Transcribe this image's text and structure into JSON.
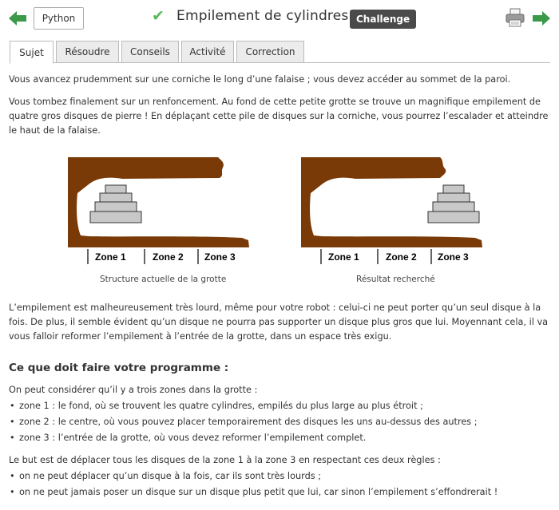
{
  "header": {
    "language_button": "Python",
    "title": "Empilement de cylindres",
    "badge": "Challenge",
    "accent_green": "#5cb85c"
  },
  "tabs": [
    {
      "label": "Sujet",
      "active": true
    },
    {
      "label": "Résoudre",
      "active": false
    },
    {
      "label": "Conseils",
      "active": false
    },
    {
      "label": "Activité",
      "active": false
    },
    {
      "label": "Correction",
      "active": false
    }
  ],
  "content": {
    "p1": "Vous avancez prudemment sur une corniche le long d’une falaise ; vous devez accéder au sommet de la paroi.",
    "p2_line1": "Vous tombez finalement sur un renfoncement. Au fond de cette petite grotte se trouve un magnifique empilement de",
    "p2_line2": "quatre gros disques de pierre ! En déplaçant cette pile de disques sur la corniche, vous pourrez l’escalader et atteindre",
    "p2_line3": "le haut de la falaise.",
    "figures": {
      "zone1": "Zone 1",
      "zone2": "Zone 2",
      "zone3": "Zone 3",
      "caption_left": "Structure actuelle de la grotte",
      "caption_right": "Résultat recherché"
    },
    "p3_line1": "L’empilement est malheureusement très lourd, même pour votre robot : celui-ci ne peut porter qu’un seul disque à la",
    "p3_line2": "fois. De plus, il semble évident qu’un disque ne pourra pas supporter un disque plus gros que lui. Moyennant cela, il va",
    "p3_line3": "vous falloir reformer l’empilement à l’entrée de la grotte, dans un espace très exigu.",
    "heading": "Ce que doit faire votre programme :",
    "p4": "On peut considérer qu’il y a trois zones dans la grotte :",
    "zones": [
      "zone 1 : le fond, où se trouvent les quatre cylindres, empilés du plus large au plus étroit ;",
      "zone 2 : le centre, où vous pouvez placer temporairement des disques les uns au-dessus des autres ;",
      "zone 3 : l’entrée de la grotte, où vous devez reformer l’empilement complet."
    ],
    "p5": "Le but est de déplacer tous les disques de la zone 1 à la zone 3 en respectant ces deux règles :",
    "rules": [
      "on ne peut déplacer qu’un disque à la fois, car ils sont très lourds ;",
      "on ne peut jamais poser un disque sur un disque plus petit que lui, car sinon l’empilement s’effondrerait !"
    ]
  },
  "colors": {
    "rock_brown": "#7a3a07",
    "disk_gray": "#c8c8c8"
  }
}
